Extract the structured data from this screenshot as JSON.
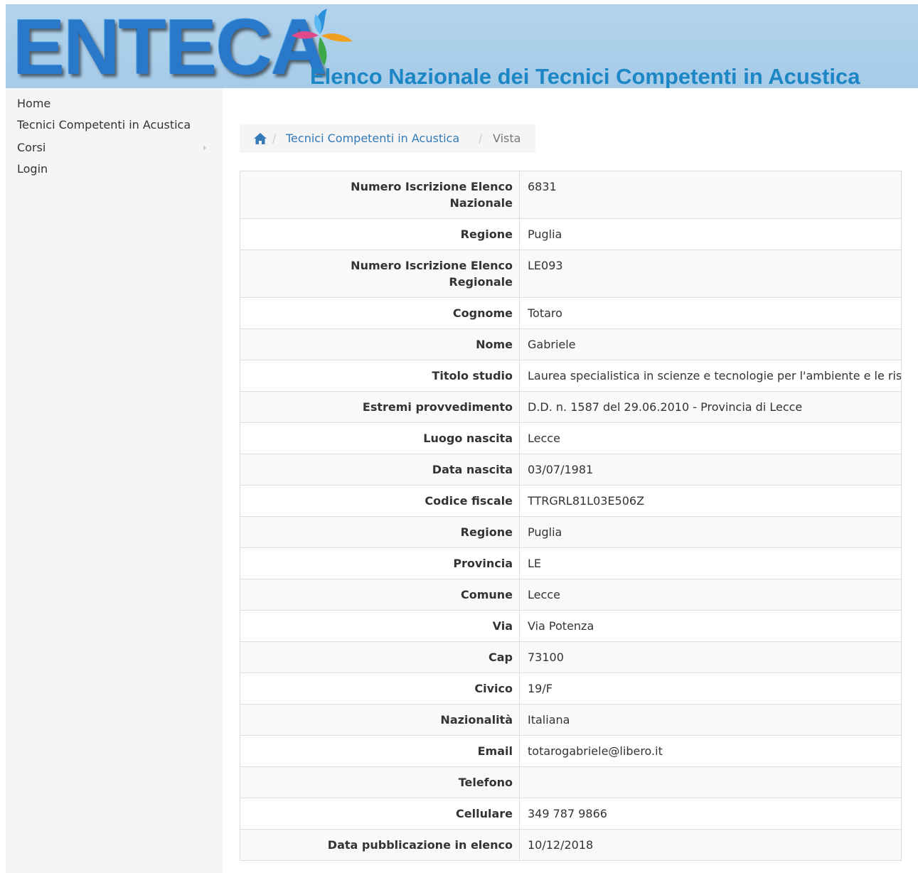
{
  "header": {
    "logo_text": "ENTECA",
    "subtitle": "Elenco Nazionale dei Tecnici Competenti in Acustica"
  },
  "sidebar": {
    "items": [
      {
        "label": "Home"
      },
      {
        "label": "Tecnici Competenti in Acustica"
      },
      {
        "label": "Corsi"
      },
      {
        "label": "Login"
      }
    ]
  },
  "breadcrumb": {
    "home_icon": "home-icon",
    "separator": "/",
    "link": "Tecnici Competenti in Acustica",
    "active": "Vista"
  },
  "details": [
    {
      "label": "Numero Iscrizione Elenco Nazionale",
      "value": "6831"
    },
    {
      "label": "Regione",
      "value": "Puglia"
    },
    {
      "label": "Numero Iscrizione Elenco Regionale",
      "value": "LE093"
    },
    {
      "label": "Cognome",
      "value": "Totaro"
    },
    {
      "label": "Nome",
      "value": "Gabriele"
    },
    {
      "label": "Titolo studio",
      "value": "Laurea specialistica in scienze e tecnologie per l'ambiente e le risorse"
    },
    {
      "label": "Estremi provvedimento",
      "value": "D.D. n. 1587 del 29.06.2010 - Provincia di Lecce"
    },
    {
      "label": "Luogo nascita",
      "value": "Lecce"
    },
    {
      "label": "Data nascita",
      "value": "03/07/1981"
    },
    {
      "label": "Codice fiscale",
      "value": "TTRGRL81L03E506Z"
    },
    {
      "label": "Regione",
      "value": "Puglia"
    },
    {
      "label": "Provincia",
      "value": "LE"
    },
    {
      "label": "Comune",
      "value": "Lecce"
    },
    {
      "label": "Via",
      "value": "Via Potenza"
    },
    {
      "label": "Cap",
      "value": "73100"
    },
    {
      "label": "Civico",
      "value": "19/F"
    },
    {
      "label": "Nazionalità",
      "value": "Italiana"
    },
    {
      "label": "Email",
      "value": "totarogabriele@libero.it"
    },
    {
      "label": "Telefono",
      "value": ""
    },
    {
      "label": "Cellulare",
      "value": "349 787 9866"
    },
    {
      "label": "Data pubblicazione in elenco",
      "value": "10/12/2018"
    }
  ],
  "colors": {
    "header_bg": "#a6cbe8",
    "logo": "#2a78c9",
    "subtitle": "#1d86c4",
    "link": "#337ab7",
    "sidebar_bg": "#f5f5f5"
  }
}
